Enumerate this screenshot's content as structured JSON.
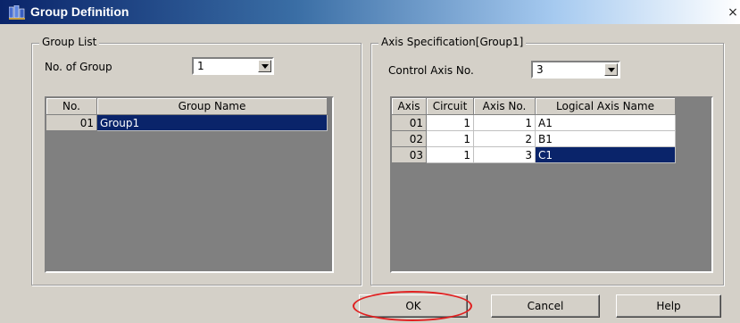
{
  "window": {
    "title": "Group Definition",
    "close_glyph": "×"
  },
  "group_list": {
    "title": "Group List",
    "num_groups_label": "No. of Group",
    "num_groups_value": "1",
    "columns": [
      "No.",
      "Group Name"
    ],
    "rows": [
      {
        "no": "01",
        "name": "Group1",
        "selected": true
      }
    ]
  },
  "axis_spec": {
    "title": "Axis Specification[Group1]",
    "control_axis_label": "Control Axis No.",
    "control_axis_value": "3",
    "columns": [
      "Axis",
      "Circuit",
      "Axis No.",
      "Logical Axis Name"
    ],
    "rows": [
      {
        "axis": "01",
        "circuit": "1",
        "axis_no": "1",
        "name": "A1",
        "selected": false
      },
      {
        "axis": "02",
        "circuit": "1",
        "axis_no": "2",
        "name": "B1",
        "selected": false
      },
      {
        "axis": "03",
        "circuit": "1",
        "axis_no": "3",
        "name": "C1",
        "selected": true
      }
    ]
  },
  "buttons": {
    "ok": "OK",
    "cancel": "Cancel",
    "help": "Help"
  },
  "colors": {
    "selection": "#0a246a",
    "dialog_bg": "#d4d0c8",
    "highlight_ring": "#e02020"
  }
}
